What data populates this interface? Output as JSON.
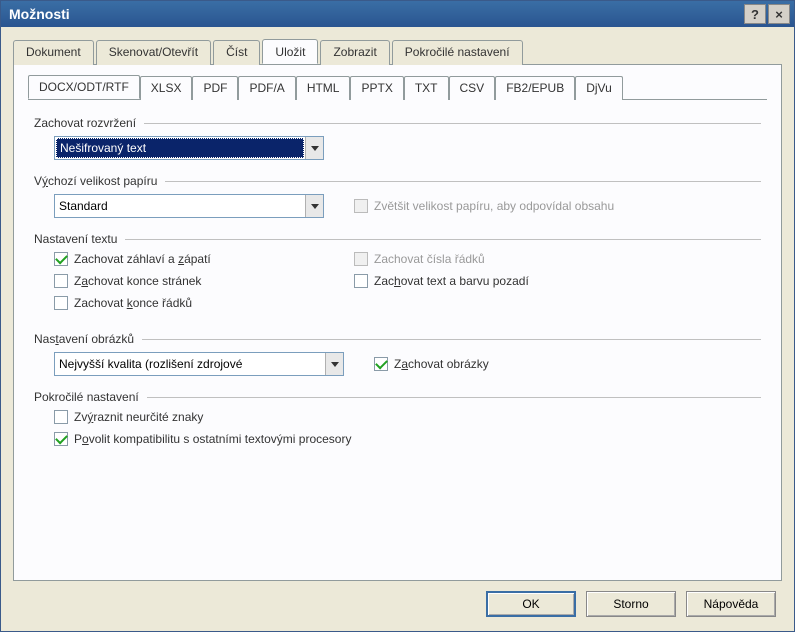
{
  "title": "Možnosti",
  "titlebar": {
    "help": "?",
    "close": "×"
  },
  "tabs": {
    "dokument": "Dokument",
    "skenovat": "Skenovat/Otevřít",
    "cist": "Číst",
    "ulozit": "Uložit",
    "zobrazit": "Zobrazit",
    "pokrocile": "Pokročilé nastavení"
  },
  "subtabs": {
    "docx": "DOCX/ODT/RTF",
    "xlsx": "XLSX",
    "pdf": "PDF",
    "pdfa": "PDF/A",
    "html": "HTML",
    "pptx": "PPTX",
    "txt": "TXT",
    "csv": "CSV",
    "fb2": "FB2/EPUB",
    "djvu": "DjVu"
  },
  "sections": {
    "layout": {
      "label": "Zachovat rozvržení",
      "value": "Nešifrovaný text"
    },
    "paper": {
      "label_pre": "V",
      "label_u": "ý",
      "label_post": "chozí velikost papíru",
      "value": "Standard",
      "enlarge": "Zvětšit velikost papíru, aby odpovídal obsahu"
    },
    "text": {
      "label": "Nastavení textu",
      "headers_pre": "Zachovat záhlaví a ",
      "headers_u": "z",
      "headers_post": "ápatí",
      "pagebreaks_pre": "Z",
      "pagebreaks_u": "a",
      "pagebreaks_post": "chovat konce stránek",
      "linebreaks_pre": "Zachovat ",
      "linebreaks_u": "k",
      "linebreaks_post": "once řádků",
      "linenumbers": "Zachovat čísla řádků",
      "bgcolor_pre": "Zac",
      "bgcolor_u": "h",
      "bgcolor_post": "ovat text a barvu pozadí"
    },
    "pictures": {
      "label_pre": "Nas",
      "label_u": "t",
      "label_post": "avení obrázků",
      "value": "Nejvyšší kvalita (rozlišení zdrojové",
      "keep_pre": "Z",
      "keep_u": "a",
      "keep_post": "chovat obrázky"
    },
    "advanced": {
      "label": "Pokročilé nastavení",
      "highlight_pre": "Zv",
      "highlight_u": "ý",
      "highlight_post": "raznit neurčité znaky",
      "compat_pre": "P",
      "compat_u": "o",
      "compat_post": "volit kompatibilitu s ostatními textovými procesory"
    }
  },
  "buttons": {
    "ok": "OK",
    "cancel": "Storno",
    "help": "Nápověda"
  }
}
